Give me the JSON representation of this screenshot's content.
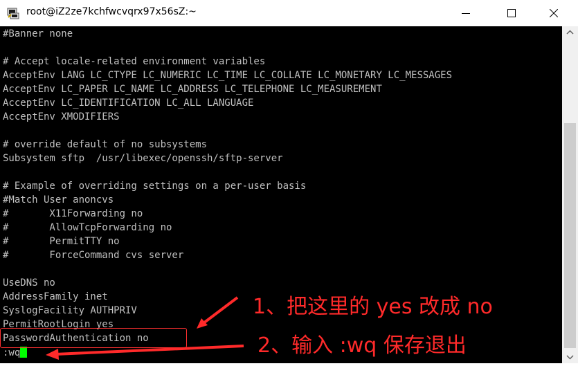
{
  "window": {
    "title": "root@iZ2ze7kchfwcvqrx97x56sZ:~"
  },
  "icons": {
    "app": "putty-terminal-icon",
    "minimize": "minimize-icon",
    "maximize": "maximize-icon",
    "close": "close-icon",
    "scroll_up": "scroll-up-arrow-icon",
    "scroll_down": "scroll-down-arrow-icon"
  },
  "terminal": {
    "lines": [
      "#Banner none",
      "",
      "# Accept locale-related environment variables",
      "AcceptEnv LANG LC_CTYPE LC_NUMERIC LC_TIME LC_COLLATE LC_MONETARY LC_MESSAGES",
      "AcceptEnv LC_PAPER LC_NAME LC_ADDRESS LC_TELEPHONE LC_MEASUREMENT",
      "AcceptEnv LC_IDENTIFICATION LC_ALL LANGUAGE",
      "AcceptEnv XMODIFIERS",
      "",
      "# override default of no subsystems",
      "Subsystem sftp  /usr/libexec/openssh/sftp-server",
      "",
      "# Example of overriding settings on a per-user basis",
      "#Match User anoncvs",
      "#       X11Forwarding no",
      "#       AllowTcpForwarding no",
      "#       PermitTTY no",
      "#       ForceCommand cvs server",
      "",
      "UseDNS no",
      "AddressFamily inet",
      "SyslogFacility AUTHPRIV",
      "PermitRootLogin yes",
      "PasswordAuthentication no"
    ],
    "command": ":wq"
  },
  "annotations": {
    "step1": "1、把这里的 yes 改成 no",
    "step2": "2、输入 :wq 保存退出"
  },
  "colors": {
    "terminal_bg": "#000000",
    "terminal_text": "#c0c0c0",
    "cursor": "#00ff00",
    "annotation": "#ff2a2a",
    "highlight_border": "#ff3030"
  }
}
